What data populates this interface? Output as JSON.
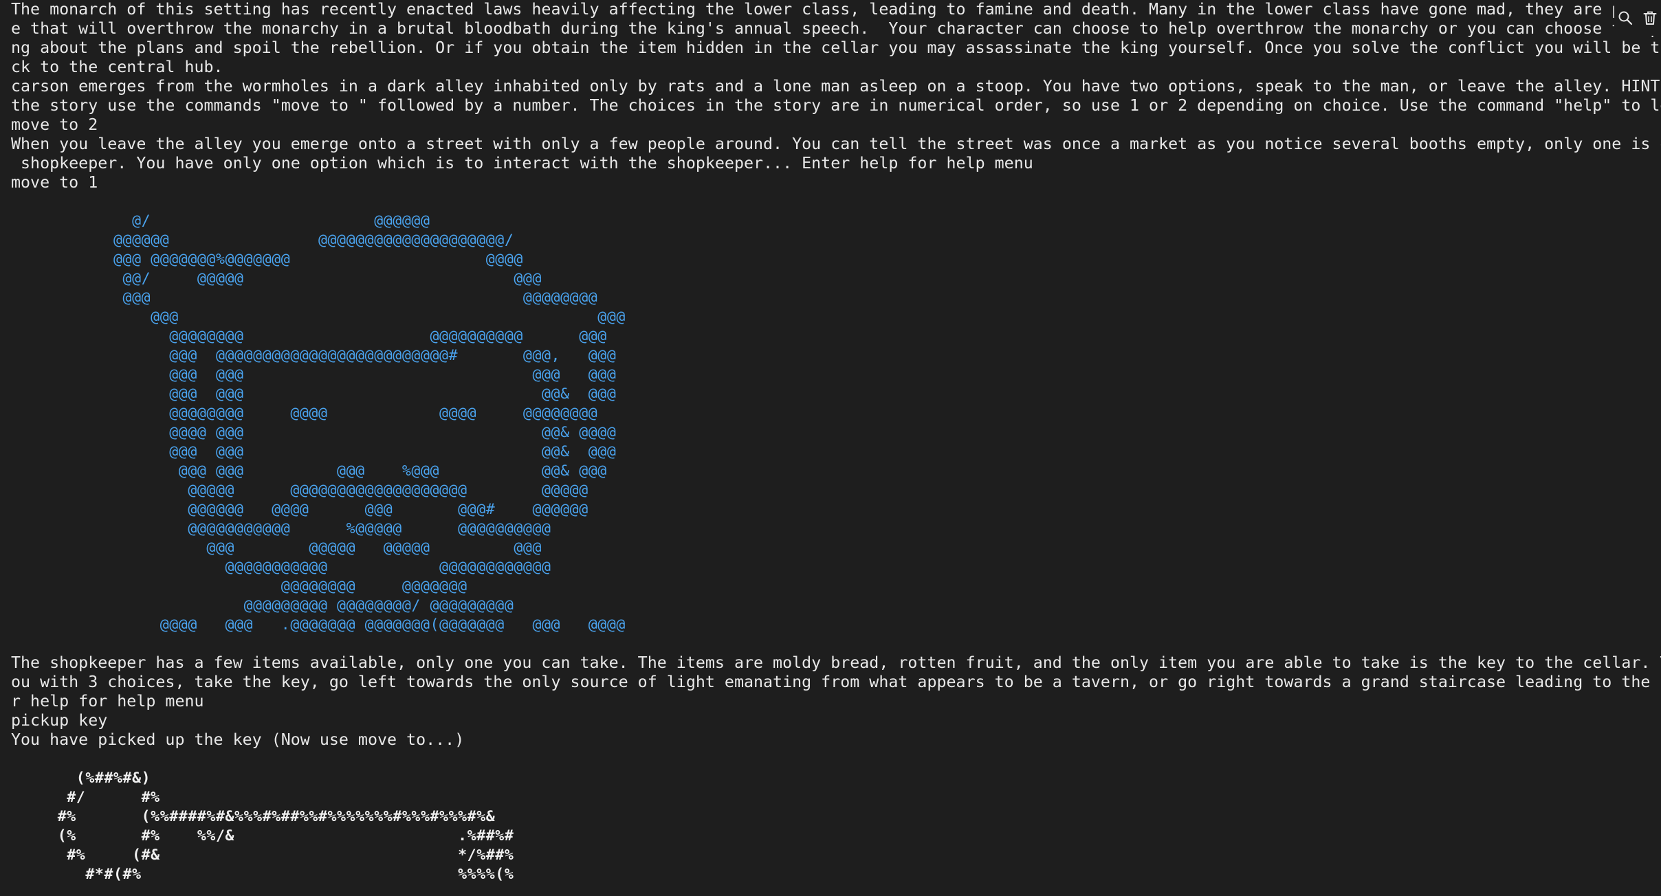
{
  "terminal": {
    "lines": [
      "The monarch of this setting has recently enacted laws heavily affecting the lower class, leading to famine and death. Many in the lower class have gone mad, they are plotting a ma",
      "e that will overthrow the monarchy in a brutal bloodbath during the king's annual speech.  Your character can choose to help overthrow the monarchy or you can choose to speak to the ki",
      "ng about the plans and spoil the rebellion. Or if you obtain the item hidden in the cellar you may assassinate the king yourself. Once you solve the conflict you will be transported ba",
      "ck to the central hub.",
      "carson emerges from the wormholes in a dark alley inhabited only by rats and a lone man asleep on a stoop. You have two options, speak to the man, or leave the alley. HINT: Throughout",
      "the story use the commands \"move to \" followed by a number. The choices in the story are in numerical order, so use 1 or 2 depending on choice. Use the command \"help\" to learn more...",
      "move to 2",
      "When you leave the alley you emerge onto a street with only a few people around. You can tell the street was once a market as you notice several booths empty, only one is occupied by a",
      " shopkeeper. You have only one option which is to interact with the shopkeeper... Enter help for help menu",
      "move to 1",
      "The shopkeeper has a few items available, only one you can take. The items are moldy bread, rotten fruit, and the only item you are able to take is the key to the cellar. This leaves y",
      "ou with 3 choices, take the key, go left towards the only source of light emanating from what appears to be a tavern, or go right towards a grand staircase leading to the castle . Ente",
      "r help for help menu",
      "pickup key",
      "You have picked up the key (Now use move to...)"
    ],
    "art_face": [
      "             @/                        @@@@@@",
      "           @@@@@@                @@@@@@@@@@@@@@@@@@@@/",
      "           @@@ @@@@@@@%@@@@@@@                     @@@@",
      "            @@/     @@@@@                             @@@",
      "            @@@                                        @@@@@@@@",
      "               @@@                                             @@@",
      "                 @@@@@@@@                    @@@@@@@@@@      @@@",
      "                 @@@  @@@@@@@@@@@@@@@@@@@@@@@@@#       @@@,   @@@",
      "                 @@@  @@@                               @@@   @@@",
      "                 @@@  @@@                                @@&  @@@",
      "                 @@@@@@@@     @@@@            @@@@     @@@@@@@@",
      "                 @@@@ @@@                                @@& @@@@",
      "                 @@@  @@@                                @@&  @@@",
      "                  @@@ @@@          @@@    %@@@           @@& @@@",
      "                   @@@@@      @@@@@@@@@@@@@@@@@@@        @@@@@",
      "                   @@@@@@   @@@@      @@@       @@@#    @@@@@@",
      "                   @@@@@@@@@@@      %@@@@@      @@@@@@@@@@",
      "                     @@@        @@@@@   @@@@@         @@@",
      "                       @@@@@@@@@@@            @@@@@@@@@@@@",
      "                             @@@@@@@@     @@@@@@@",
      "                         @@@@@@@@@ @@@@@@@@/ @@@@@@@@@",
      "                @@@@   @@@   .@@@@@@@ @@@@@@@(@@@@@@@   @@@   @@@@"
    ],
    "art_key": [
      "       (%##%#&)",
      "      #/      #%",
      "     #%       (%%####%#&%%%#%##%%#%%%%%%%#%%%#%%%#%&",
      "     (%       #%    %%/&                        .%##%#",
      "      #%     (#&                                */%##%",
      "        #*#(#%                                  %%%%(%"
    ]
  },
  "toolbar": {
    "icons": [
      "search-icon",
      "trash-icon"
    ]
  }
}
